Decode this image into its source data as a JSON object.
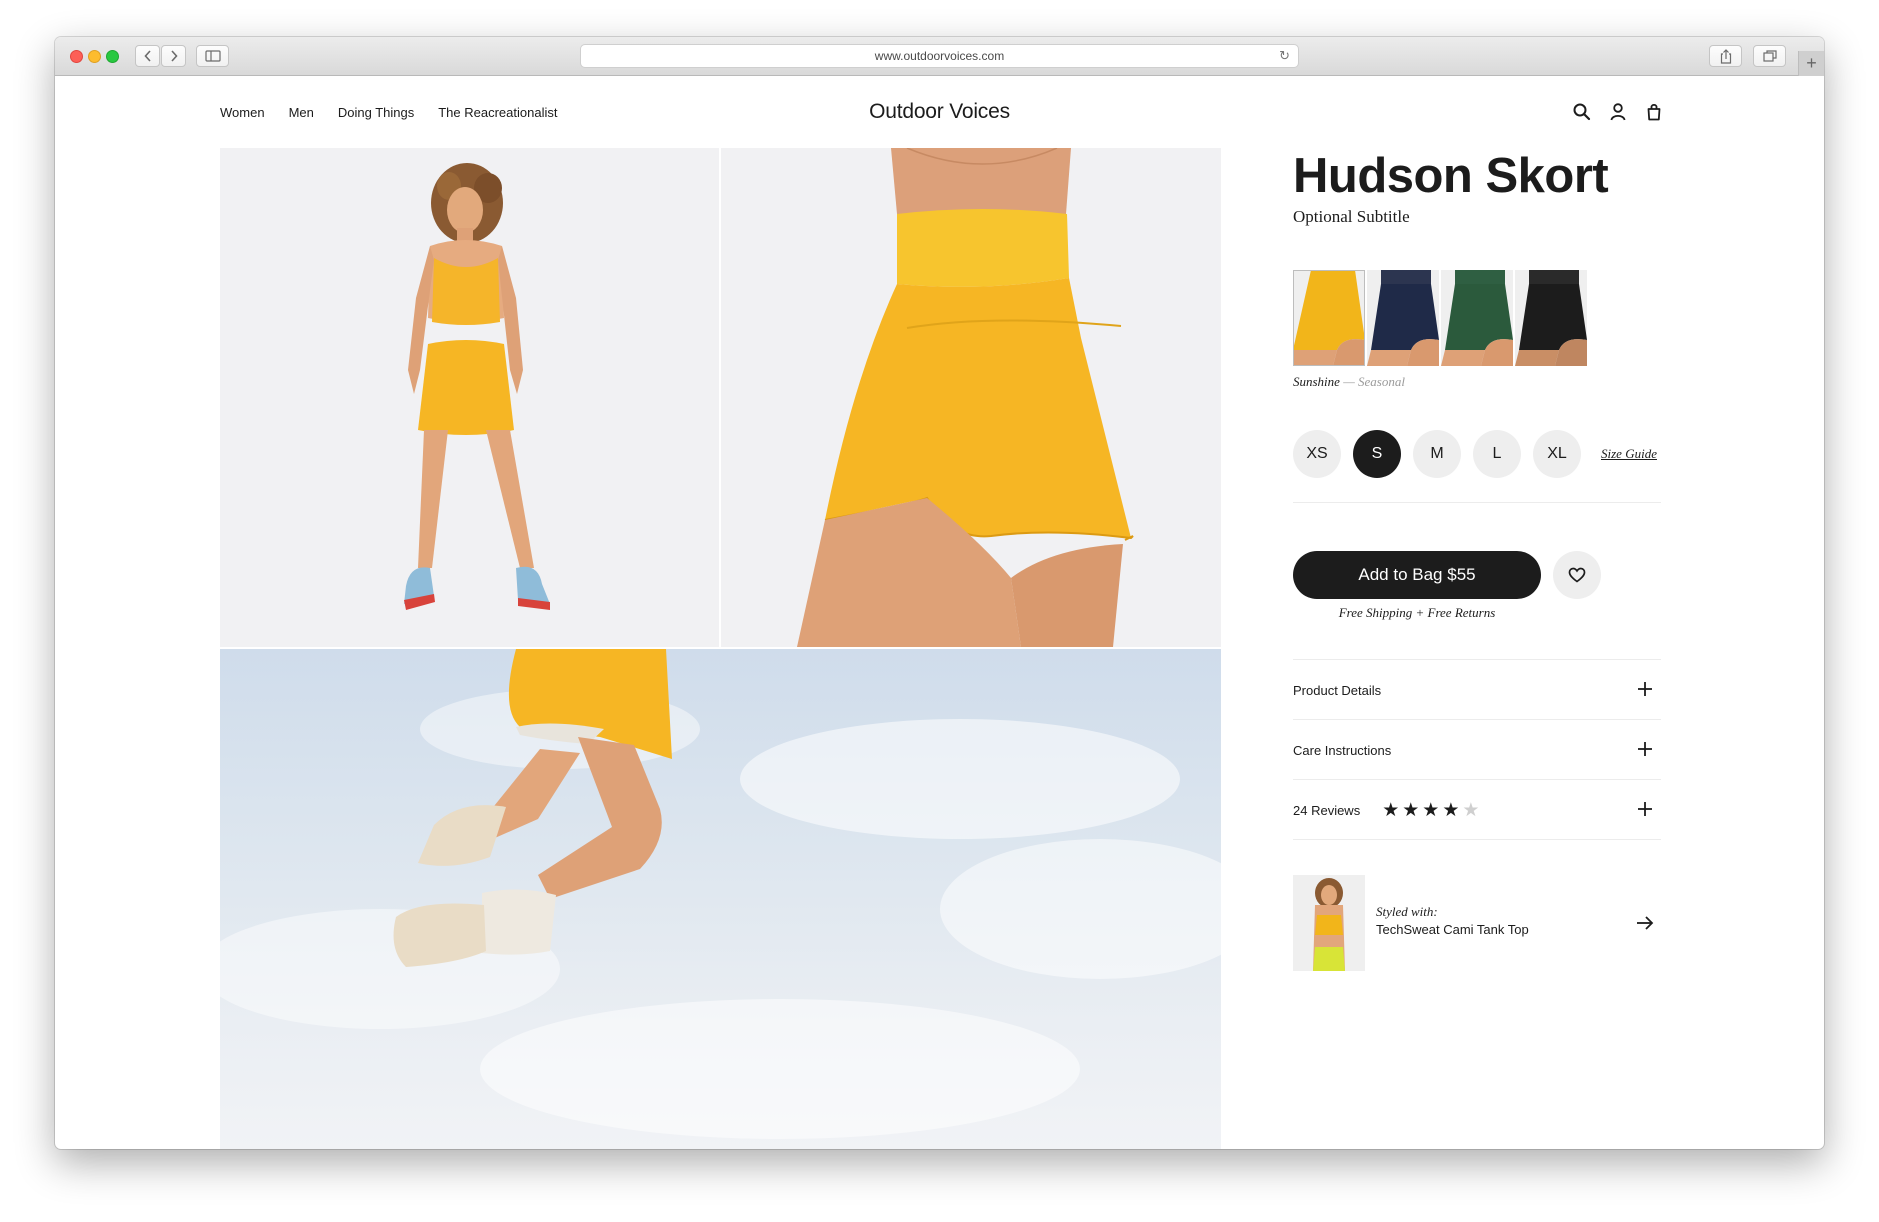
{
  "browser": {
    "url": "www.outdoorvoices.com",
    "new_tab_symbol": "+"
  },
  "header": {
    "nav": [
      "Women",
      "Men",
      "Doing Things",
      "The Reacreationalist"
    ],
    "logo": "Outdoor Voices"
  },
  "product": {
    "title": "Hudson Skort",
    "subtitle": "Optional Subtitle",
    "color_name": "Sunshine",
    "color_separator": " — ",
    "color_note": "Seasonal",
    "swatch_colors": [
      "#f2b51a",
      "#1f2a48",
      "#2b5a3c",
      "#1c1c1c"
    ],
    "sizes": [
      "XS",
      "S",
      "M",
      "L",
      "XL"
    ],
    "selected_size": "S",
    "size_guide": "Size Guide",
    "add_to_bag": "Add to Bag $55",
    "shipping_note": "Free Shipping + Free Returns",
    "accordions": [
      "Product Details",
      "Care Instructions"
    ],
    "reviews": {
      "label": "24 Reviews",
      "rating": 4,
      "max": 5
    },
    "styled_with": {
      "label": "Styled with:",
      "product": "TechSweat Cami Tank Top"
    }
  },
  "colors": {
    "accent_dark": "#1c1c1c",
    "skort_yellow": "#f6b624"
  }
}
